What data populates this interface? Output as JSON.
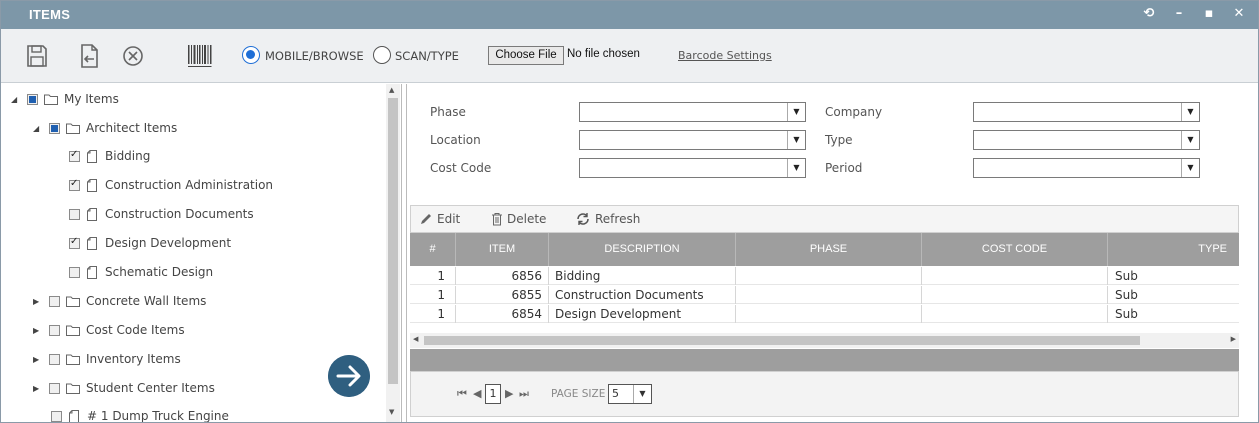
{
  "window": {
    "title": "ITEMS",
    "controls": {
      "refresh": "⟲",
      "minimize": "–",
      "maximize": "▪",
      "close": "✕"
    }
  },
  "toolbar": {
    "scan_modes": [
      {
        "label": "MOBILE/BROWSE",
        "selected": true
      },
      {
        "label": "SCAN/TYPE",
        "selected": false
      }
    ],
    "file_button": "Choose File",
    "file_status": "No file chosen",
    "barcode_settings": "Barcode Settings"
  },
  "tree": {
    "nodes": [
      {
        "label": "My Items",
        "type": "folder",
        "expander": "◢",
        "check": "partial"
      },
      {
        "label": "Architect Items",
        "type": "folder",
        "expander": "◢",
        "check": "partial"
      },
      {
        "label": "Bidding",
        "type": "doc",
        "expander": "",
        "check": "checked"
      },
      {
        "label": "Construction Administration",
        "type": "doc",
        "expander": "",
        "check": "checked"
      },
      {
        "label": "Construction Documents",
        "type": "doc",
        "expander": "",
        "check": "none"
      },
      {
        "label": "Design Development",
        "type": "doc",
        "expander": "",
        "check": "checked"
      },
      {
        "label": "Schematic Design",
        "type": "doc",
        "expander": "",
        "check": "none"
      },
      {
        "label": "Concrete Wall Items",
        "type": "folder",
        "expander": "▶",
        "check": "none"
      },
      {
        "label": "Cost Code Items",
        "type": "folder",
        "expander": "▶",
        "check": "none"
      },
      {
        "label": "Inventory Items",
        "type": "folder",
        "expander": "▶",
        "check": "none"
      },
      {
        "label": "Student Center Items",
        "type": "folder",
        "expander": "▶",
        "check": "none"
      },
      {
        "label": "# 1 Dump Truck Engine",
        "type": "doc",
        "expander": "",
        "check": "none"
      }
    ]
  },
  "filters": {
    "phase": "Phase",
    "location": "Location",
    "cost_code": "Cost Code",
    "company": "Company",
    "type": "Type",
    "period": "Period",
    "arrow": "▼"
  },
  "grid": {
    "toolbar": {
      "edit": "Edit",
      "delete": "Delete",
      "refresh": "Refresh"
    },
    "columns": [
      "#",
      "ITEM",
      "DESCRIPTION",
      "PHASE",
      "COST CODE",
      "TYPE"
    ],
    "rows": [
      {
        "num": "1",
        "item": "6856",
        "description": "Bidding",
        "phase": "",
        "cost_code": "",
        "type": "Sub"
      },
      {
        "num": "1",
        "item": "6855",
        "description": "Construction Documents",
        "phase": "",
        "cost_code": "",
        "type": "Sub"
      },
      {
        "num": "1",
        "item": "6854",
        "description": "Design Development",
        "phase": "",
        "cost_code": "",
        "type": "Sub"
      }
    ],
    "pager": {
      "first": "⏮",
      "prev": "◀",
      "current_page": "1",
      "next": "▶",
      "last": "⏭",
      "page_size_label": "PAGE SIZE",
      "page_size": "5",
      "arrow": "▼"
    }
  },
  "colors": {
    "titlebar": "#7d97a8",
    "accent": "#1f6fd6",
    "grid_header": "#9e9e9e",
    "nav_button": "#2f5f80"
  }
}
